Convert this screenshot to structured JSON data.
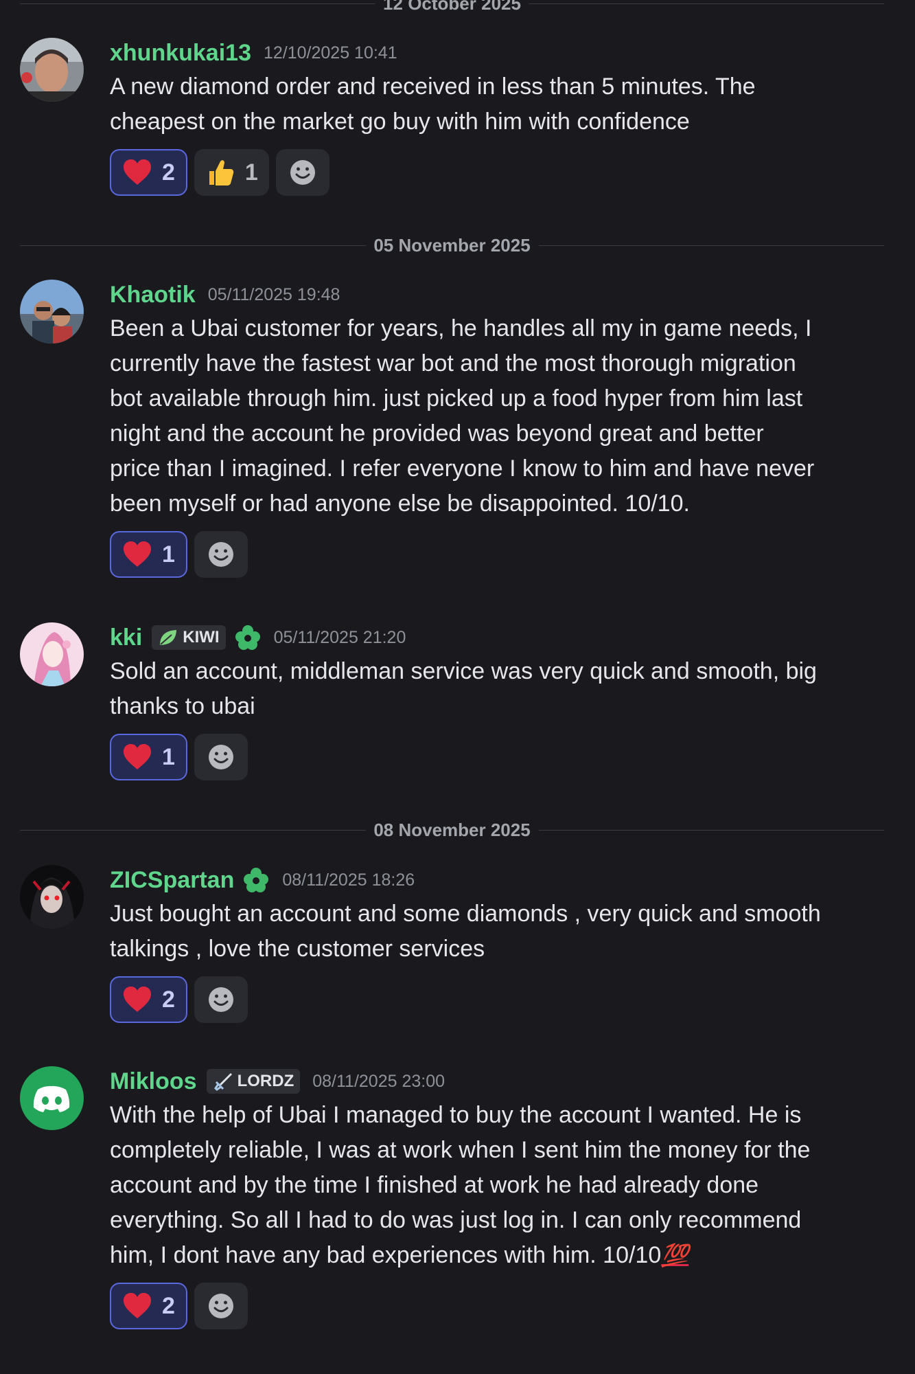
{
  "dividers": [
    {
      "label": "12 October 2025"
    },
    {
      "label": "05 November 2025"
    },
    {
      "label": "08 November 2025"
    }
  ],
  "messages": [
    {
      "username": "xhunkukai13",
      "timestamp": "12/10/2025 10:41",
      "lines": [
        "A new diamond order and received in less than 5 minutes. The",
        "cheapest on the market go buy with him with confidence"
      ],
      "reactions": [
        {
          "emoji": "heart",
          "count": "2"
        },
        {
          "emoji": "thumbs-up",
          "count": "1"
        }
      ]
    },
    {
      "username": "Khaotik",
      "timestamp": "05/11/2025 19:48",
      "lines": [
        "Been a Ubai customer for years, he handles all my in game needs, I",
        "currently have the fastest war bot and the most thorough migration",
        "bot  available through him.  just picked up a food hyper from him last",
        "night and the account he provided was beyond great and better",
        "price than I imagined. I refer everyone I know to him and have never",
        "been myself or had anyone else be disappointed. 10/10."
      ],
      "reactions": [
        {
          "emoji": "heart",
          "count": "1"
        }
      ]
    },
    {
      "username": "kki",
      "tag": "KIWI",
      "timestamp": "05/11/2025 21:20",
      "lines": [
        "Sold an account, middleman service was very quick and smooth, big",
        "thanks to ubai"
      ],
      "reactions": [
        {
          "emoji": "heart",
          "count": "1"
        }
      ]
    },
    {
      "username": "ZICSpartan",
      "timestamp": "08/11/2025 18:26",
      "lines": [
        "Just bought an account and some diamonds , very quick and smooth",
        "talkings , love the customer services"
      ],
      "reactions": [
        {
          "emoji": "heart",
          "count": "2"
        }
      ]
    },
    {
      "username": "Mikloos",
      "tag": "LORDZ",
      "timestamp": "08/11/2025 23:00",
      "lines": [
        "With the help of Ubai I managed to buy the account I wanted. He is",
        "completely reliable, I was at work when I sent him the money for the",
        "account and by the time I finished at work he had already done",
        "everything. So all I had to do was just log in. I can only recommend",
        "him, I dont have any bad experiences with him. 10/10"
      ],
      "hundred_emoji": "💯",
      "reactions": [
        {
          "emoji": "heart",
          "count": "2"
        }
      ]
    }
  ],
  "colors": {
    "username": "#5fd68c",
    "reaction_active_border": "#5a68e0",
    "background": "#1a1a1e"
  }
}
